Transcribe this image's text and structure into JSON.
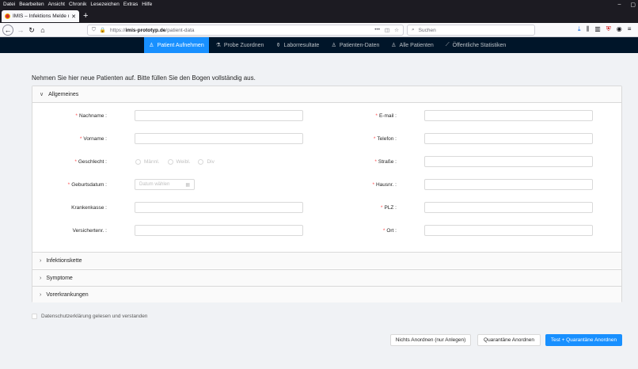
{
  "browser": {
    "menu": [
      "Datei",
      "Bearbeiten",
      "Ansicht",
      "Chronik",
      "Lesezeichen",
      "Extras",
      "Hilfe"
    ],
    "tab_title": "IMIS – Infektions Melde und In",
    "url_prefix": "https://",
    "url_host": "imis-prototyp.de",
    "url_path": "/patient-data",
    "search_placeholder": "Suchen"
  },
  "app_nav": [
    {
      "label": "Patient Aufnehmen",
      "icon": "user-add-icon",
      "glyph": "♙",
      "active": true
    },
    {
      "label": "Probe Zuordnen",
      "icon": "experiment-icon",
      "glyph": "⚗",
      "active": false
    },
    {
      "label": "Laborresultate",
      "icon": "flask-icon",
      "glyph": "⚱",
      "active": false
    },
    {
      "label": "Patienten-Daten",
      "icon": "user-icon",
      "glyph": "♙",
      "active": false
    },
    {
      "label": "Alle Patienten",
      "icon": "team-icon",
      "glyph": "♙",
      "active": false
    },
    {
      "label": "Öffentliche Statistiken",
      "icon": "chart-icon",
      "glyph": "⟋",
      "active": false
    }
  ],
  "intro": "Nehmen Sie hier neue Patienten auf. Bitte füllen Sie den Bogen vollständig aus.",
  "panels": {
    "general": "Allgemeines",
    "infection_chain": "Infektionskette",
    "symptoms": "Symptome",
    "preconditions": "Vorerkrankungen"
  },
  "form": {
    "left": [
      {
        "label": "Nachname",
        "required": true,
        "type": "text"
      },
      {
        "label": "Vorname",
        "required": true,
        "type": "text"
      },
      {
        "label": "Geschlecht",
        "required": true,
        "type": "radio"
      },
      {
        "label": "Geburtsdatum",
        "required": true,
        "type": "date"
      },
      {
        "label": "Krankenkasse",
        "required": false,
        "type": "text"
      },
      {
        "label": "Versichertenr.",
        "required": false,
        "type": "text"
      }
    ],
    "right": [
      {
        "label": "E-mail",
        "required": true
      },
      {
        "label": "Telefon",
        "required": true
      },
      {
        "label": "Straße",
        "required": true
      },
      {
        "label": "Hausnr.",
        "required": true
      },
      {
        "label": "PLZ",
        "required": true
      },
      {
        "label": "Ort",
        "required": true
      }
    ],
    "gender_options": [
      "Männl.",
      "Weibl.",
      "Div"
    ],
    "date_placeholder": "Datum wählen"
  },
  "privacy_label": "Datenschutzerklärung gelesen und verstanden",
  "buttons": {
    "nothing": "Nichts Anordnen (nur Anlegen)",
    "quarantine": "Quarantäne Anordnen",
    "test_quarantine": "Test + Quarantäne Anordnen"
  },
  "colors": {
    "primary": "#1890ff",
    "nav_bg": "#001529",
    "required": "#ff4d4f"
  }
}
